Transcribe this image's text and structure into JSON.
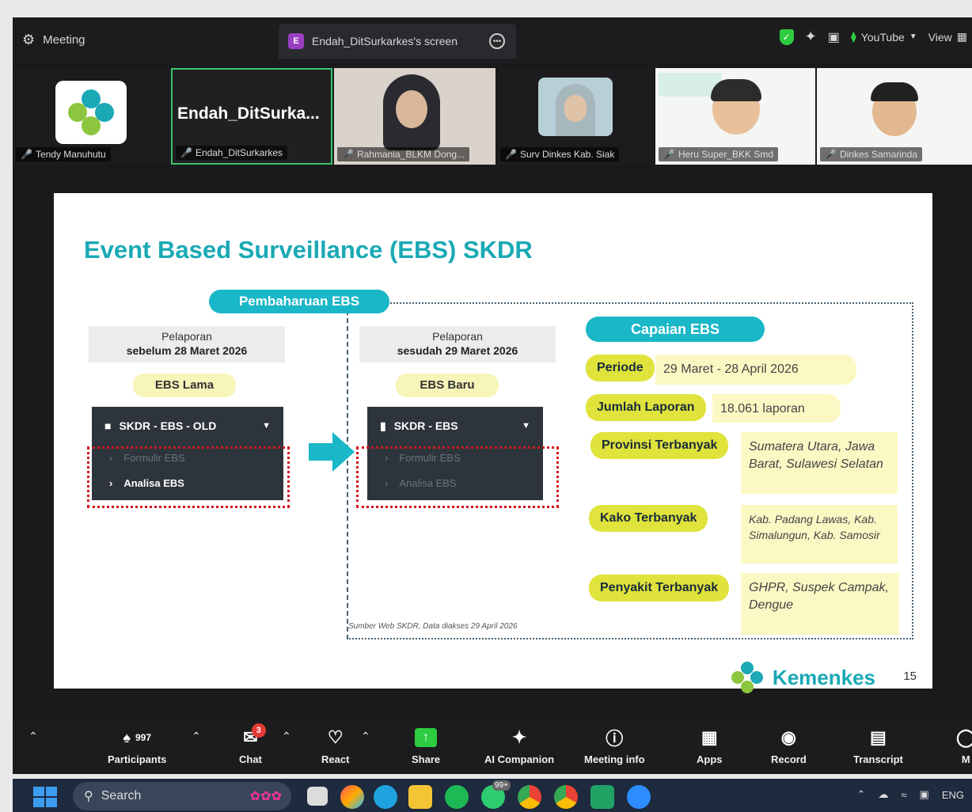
{
  "zoom": {
    "meeting_label": "Meeting",
    "share_tab_label": "Endah_DitSurkarkes's screen",
    "share_badge": "E",
    "youtube_label": "YouTube",
    "view_label": "View"
  },
  "participants": [
    {
      "name": "Tendy Manuhutu"
    },
    {
      "name": "Endah_DitSurkarkes",
      "big_name": "Endah_DitSurka..."
    },
    {
      "name": "Rahmania_BLKM Dong..."
    },
    {
      "name": "Surv Dinkes Kab. Siak"
    },
    {
      "name": "Heru Super_BKK Smd"
    },
    {
      "name": "Dinkes Samarinda"
    }
  ],
  "slide": {
    "title": "Event Based Surveillance (EBS) SKDR",
    "update_pill": "Pembaharuan EBS",
    "left": {
      "label_top": "Pelaporan",
      "label_bottom": "sebelum 28 Maret 2026",
      "version": "EBS Lama",
      "menu_title": "SKDR - EBS - OLD",
      "items": [
        "Formulir EBS",
        "Analisa EBS"
      ]
    },
    "middle": {
      "label_top": "Pelaporan",
      "label_bottom": "sesudah 29 Maret 2026",
      "version": "EBS Baru",
      "menu_title": "SKDR - EBS",
      "items": [
        "Formulir EBS",
        "Analisa EBS"
      ]
    },
    "capaian": {
      "heading": "Capaian EBS",
      "rows": [
        {
          "label": "Periode",
          "value": "29 Maret - 28 April 2026"
        },
        {
          "label": "Jumlah Laporan",
          "value": "18.061 laporan"
        },
        {
          "label": "Provinsi Terbanyak",
          "value": "Sumatera Utara, Jawa Barat, Sulawesi Selatan"
        },
        {
          "label": "Kako Terbanyak",
          "value": "Kab. Padang Lawas, Kab. Simalungun, Kab. Samosir"
        },
        {
          "label": "Penyakit Terbanyak",
          "value": "GHPR, Suspek Campak, Dengue"
        }
      ]
    },
    "source_note": "Sumber Web SKDR, Data diakses 29 April 2026",
    "brand": "Kemenkes",
    "page_number": "15"
  },
  "toolbar": {
    "participants_label": "Participants",
    "participants_count": "997",
    "chat_label": "Chat",
    "chat_badge": "3",
    "react_label": "React",
    "share_label": "Share",
    "ai_label": "AI Companion",
    "info_label": "Meeting info",
    "apps_label": "Apps",
    "record_label": "Record",
    "transcript_label": "Transcript",
    "more_label": "M"
  },
  "taskbar": {
    "search_placeholder": "Search",
    "whatsapp_badge": "99+",
    "lang": "ENG"
  }
}
